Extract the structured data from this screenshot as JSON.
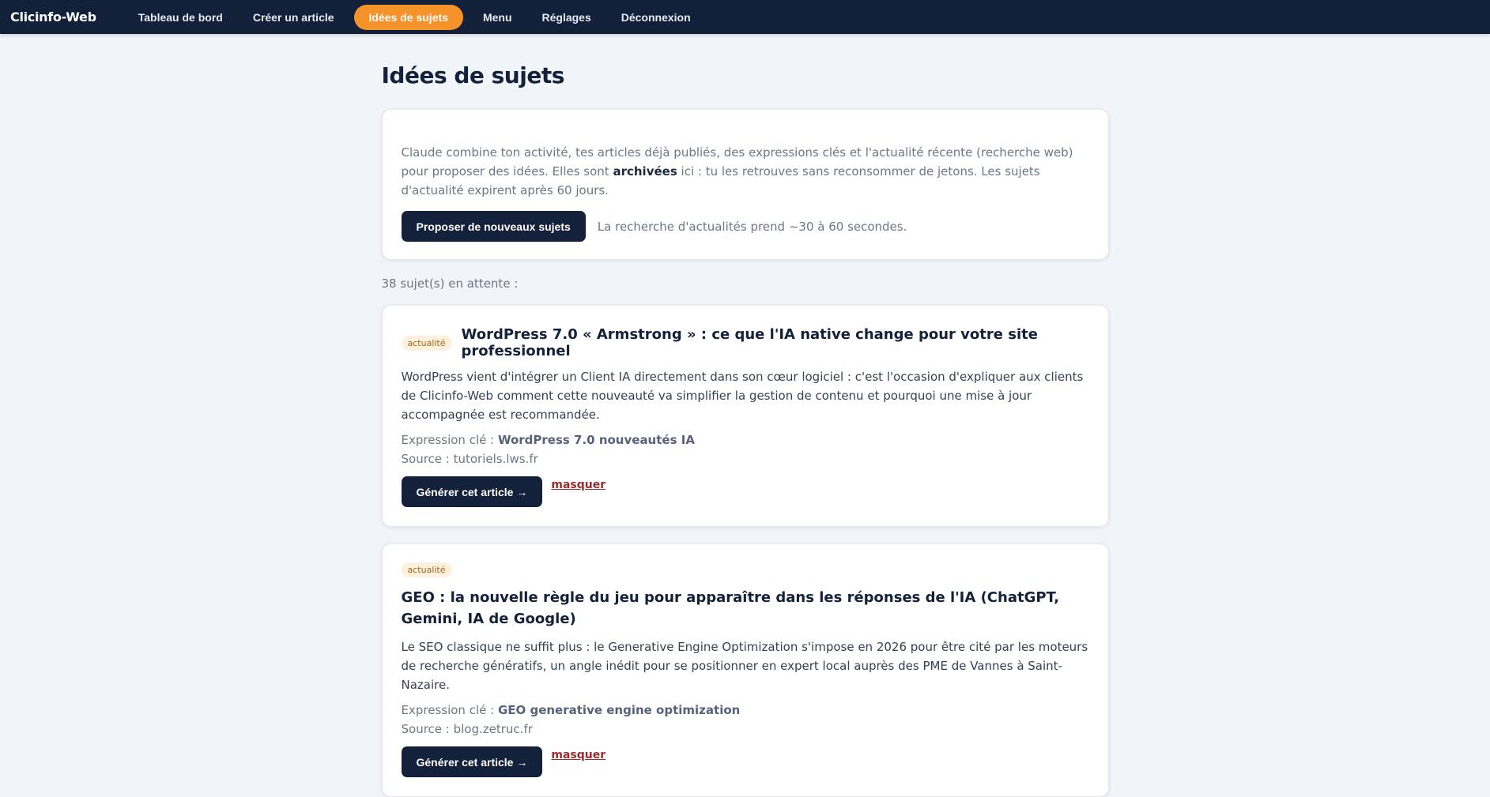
{
  "header": {
    "brand": "Clicinfo-Web",
    "nav": [
      {
        "label": "Tableau de bord",
        "active": false
      },
      {
        "label": "Créer un article",
        "active": false
      },
      {
        "label": "Idées de sujets",
        "active": true
      },
      {
        "label": "Menu",
        "active": false
      },
      {
        "label": "Réglages",
        "active": false
      },
      {
        "label": "Déconnexion",
        "active": false
      }
    ]
  },
  "page": {
    "title": "Idées de sujets",
    "intro": {
      "text_before": "Claude combine ton activité, tes articles déjà publiés, des expressions clés et l'actualité récente (recherche web) pour proposer des idées. Elles sont ",
      "text_bold": "archivées",
      "text_after": " ici : tu les retrouves sans reconsommer de jetons. Les sujets d'actualité expirent après 60 jours.",
      "button_label": "Proposer de nouveaux sujets",
      "hint": "La recherche d'actualités prend ~30 à 60 secondes."
    },
    "pending_count": "38 sujet(s) en attente :",
    "ideas": [
      {
        "badge": "actualité",
        "title": "WordPress 7.0 « Armstrong » : ce que l'IA native change pour votre site professionnel",
        "description": "WordPress vient d'intégrer un Client IA directement dans son cœur logiciel : c'est l'occasion d'expliquer aux clients de Clicinfo-Web comment cette nouveauté va simplifier la gestion de contenu et pourquoi une mise à jour accompagnée est recommandée.",
        "keyword_label": "Expression clé : ",
        "keyword": "WordPress 7.0 nouveautés IA",
        "source_label": "Source : ",
        "source": "tutoriels.lws.fr",
        "generate_label": "Générer cet article →",
        "hide_label": "masquer"
      },
      {
        "badge": "actualité",
        "title": "GEO : la nouvelle règle du jeu pour apparaître dans les réponses de l'IA (ChatGPT, Gemini, IA de Google)",
        "description": "Le SEO classique ne suffit plus : le Generative Engine Optimization s'impose en 2026 pour être cité par les moteurs de recherche génératifs, un angle inédit pour se positionner en expert local auprès des PME de Vannes à Saint-Nazaire.",
        "keyword_label": "Expression clé : ",
        "keyword": "GEO generative engine optimization",
        "source_label": "Source : ",
        "source": "blog.zetruc.fr",
        "generate_label": "Générer cet article →",
        "hide_label": "masquer"
      }
    ]
  },
  "colors": {
    "navbar": "#13203a",
    "accent": "#f5922a",
    "button": "#14213b",
    "link_danger": "#9b2c2c",
    "badge_bg": "#fdf0dc"
  }
}
